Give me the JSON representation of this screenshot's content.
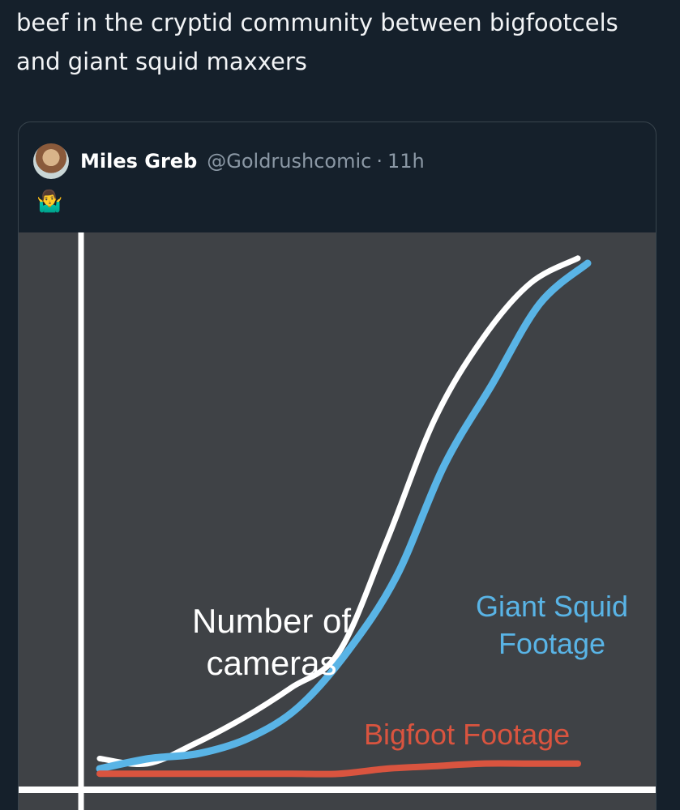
{
  "post": {
    "text": "beef in the cryptid community between bigfootcels and giant squid maxxers"
  },
  "quote": {
    "author_name": "Miles Greb",
    "author_handle": "@Goldrushcomic",
    "separator": "·",
    "time": "11h",
    "emoji": "🤷‍♂️"
  },
  "chart_data": {
    "type": "line",
    "title": "",
    "xlabel": "",
    "ylabel": "",
    "grid": false,
    "x": [
      0,
      1,
      2,
      3,
      4,
      5,
      6,
      7,
      8,
      9,
      10
    ],
    "series": [
      {
        "name": "Number of cameras",
        "color": "#ffffff",
        "values": [
          2,
          1,
          5,
          10,
          16,
          23,
          45,
          69,
          85,
          96,
          101
        ]
      },
      {
        "name": "Giant Squid Footage",
        "color": "#59b4e6",
        "values": [
          0,
          2,
          3,
          6,
          12,
          23,
          38,
          60,
          76,
          92,
          100
        ]
      },
      {
        "name": "Bigfoot Footage",
        "color": "#d9543f",
        "values": [
          -1,
          -1,
          -1,
          -1,
          -1,
          -1,
          0,
          0.5,
          1,
          1,
          1
        ]
      }
    ],
    "labels": {
      "cameras_line1": "Number of",
      "cameras_line2": "cameras",
      "squid_line1": "Giant Squid",
      "squid_line2": "Footage",
      "bigfoot": "Bigfoot Footage"
    }
  }
}
